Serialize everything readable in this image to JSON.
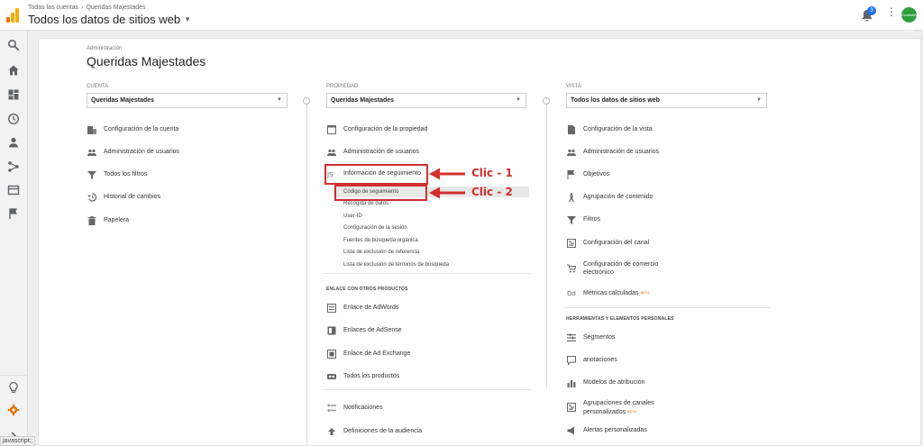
{
  "header": {
    "breadcrumb": [
      "Todas las cuentas",
      "Queridas Majestades"
    ],
    "property_title": "Todos los datos de sitios web",
    "notifications_count": "3",
    "avatar_text": "Ecodiseño Hogar"
  },
  "admin": {
    "label": "Administración",
    "title": "Queridas Majestades"
  },
  "cuenta": {
    "label": "CUENTA",
    "selected": "Queridas Majestades",
    "items": [
      {
        "label": "Configuración de la cuenta",
        "icon": "building-icon"
      },
      {
        "label": "Administración de usuarios",
        "icon": "users-icon"
      },
      {
        "label": "Todos los filtros",
        "icon": "filter-icon"
      },
      {
        "label": "Historial de cambios",
        "icon": "history-icon"
      },
      {
        "label": "Papelera",
        "icon": "trash-icon"
      }
    ]
  },
  "propiedad": {
    "label": "PROPIEDAD",
    "selected": "Queridas Majestades",
    "items": [
      {
        "label": "Configuración de la propiedad",
        "icon": "window-icon"
      },
      {
        "label": "Administración de usuarios",
        "icon": "users-icon"
      },
      {
        "label": "Información de seguimiento",
        "icon": "js-icon"
      }
    ],
    "tracking_subitems": [
      "Código de seguimiento",
      "Recogida de datos",
      "User-ID",
      "Configuración de la sesión",
      "Fuentes de búsqueda orgánica",
      "Lista de exclusión de referencia",
      "Lista de exclusión de términos de búsqueda"
    ],
    "linking_header": "ENLACE CON OTROS PRODUCTOS",
    "linking_items": [
      {
        "label": "Enlace de AdWords",
        "icon": "adwords-icon"
      },
      {
        "label": "Enlaces de AdSense",
        "icon": "adsense-icon"
      },
      {
        "label": "Enlace de Ad Exchange",
        "icon": "adexchange-icon"
      },
      {
        "label": "Todos los productos",
        "icon": "products-icon"
      }
    ],
    "bottom_items": [
      {
        "label": "Notificaciones",
        "icon": "notifications-icon"
      },
      {
        "label": "Definiciones de la audiencia",
        "icon": "audience-icon"
      }
    ]
  },
  "vista": {
    "label": "VISTA",
    "selected": "Todos los datos de sitios web",
    "items": [
      {
        "label": "Configuración de la vista",
        "icon": "doc-icon"
      },
      {
        "label": "Administración de usuarios",
        "icon": "users-icon"
      },
      {
        "label": "Objetivos",
        "icon": "flag-icon"
      },
      {
        "label": "Agrupación de contenido",
        "icon": "person-icon"
      },
      {
        "label": "Filtros",
        "icon": "filter-icon"
      },
      {
        "label": "Configuración del canal",
        "icon": "channel-icon"
      },
      {
        "label": "Configuración de comercio electrónico",
        "icon": "cart-icon"
      },
      {
        "label": "Métricas calculadas",
        "icon": "dd-icon",
        "badge": "BETA"
      }
    ],
    "tools_header": "HERRAMIENTAS Y ELEMENTOS PERSONALES",
    "tools_items": [
      {
        "label": "Segmentos",
        "icon": "segments-icon"
      },
      {
        "label": "anotaciones",
        "icon": "annotation-icon"
      },
      {
        "label": "Modelos de atribución",
        "icon": "bar-chart-icon"
      },
      {
        "label": "Agrupaciones de canales personalizados",
        "icon": "channel-icon",
        "badge": "BETA"
      },
      {
        "label": "Alertas personalizadas",
        "icon": "megaphone-icon"
      }
    ]
  },
  "annotations": {
    "clic1": "Clic - 1",
    "clic2": "Clic - 2"
  },
  "status": {
    "js": "javascript:;"
  },
  "colors": {
    "annotation_red": "#d32f2f",
    "logo_orange": "#f9ab00",
    "logo_dark_orange": "#e37400",
    "badge_blue": "#1a73e8",
    "active_gear": "#e37400"
  }
}
